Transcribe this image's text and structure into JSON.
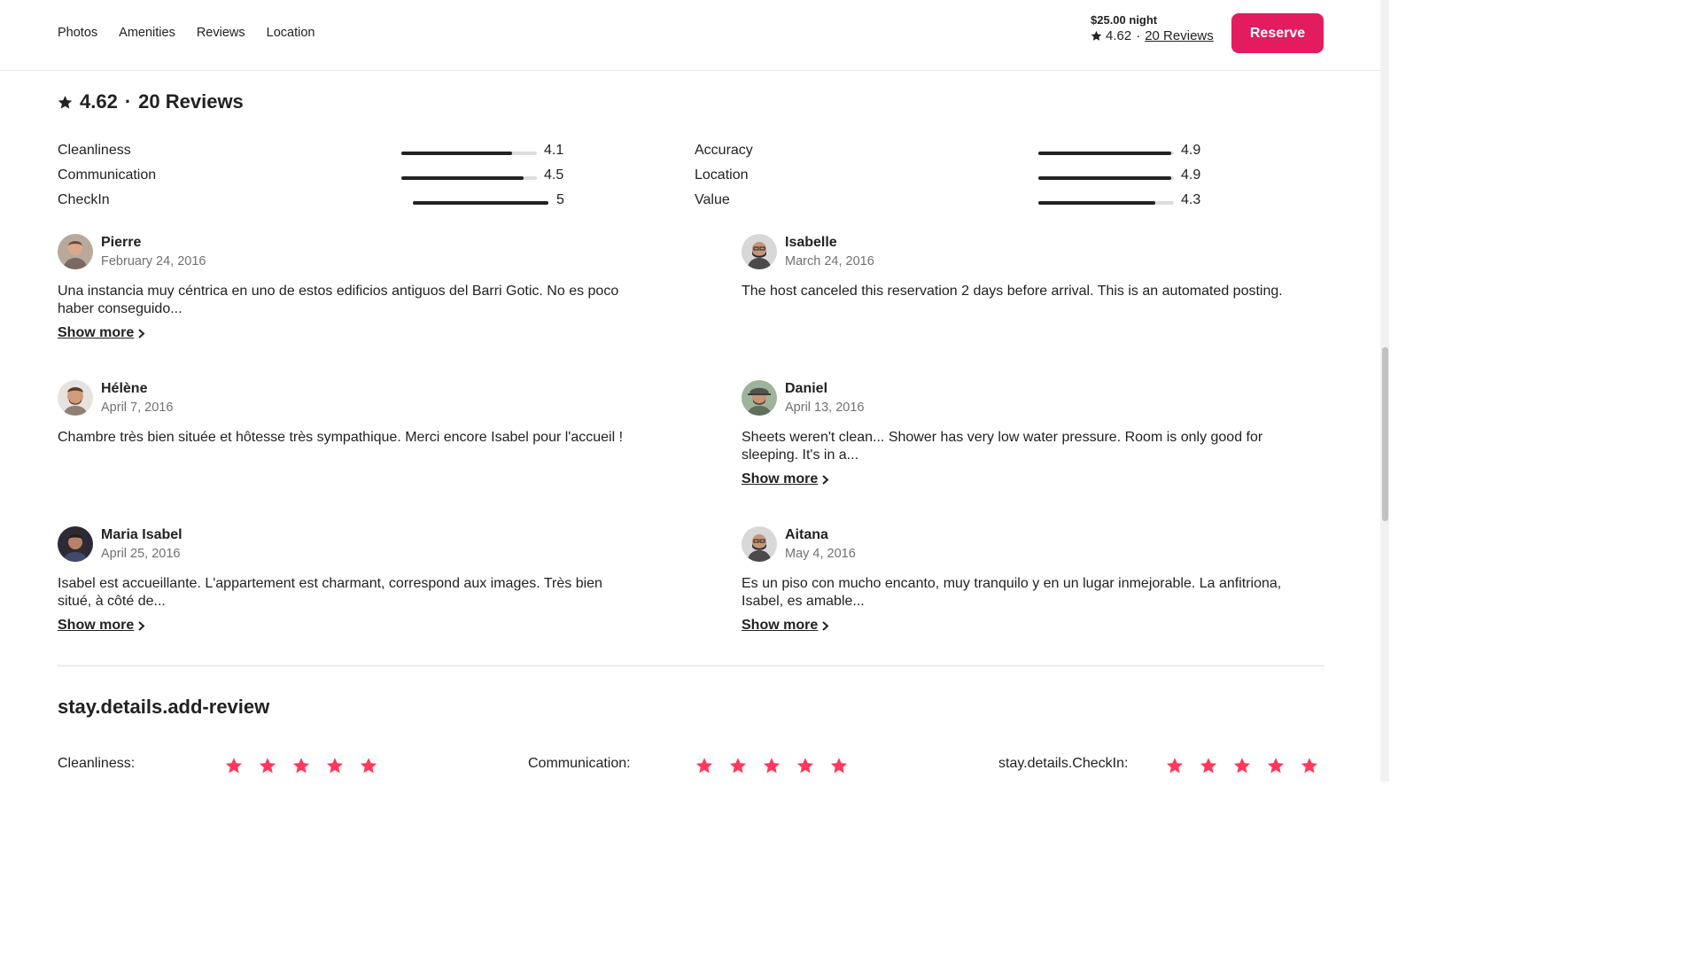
{
  "nav": {
    "items": [
      "Photos",
      "Amenities",
      "Reviews",
      "Location"
    ]
  },
  "header": {
    "price": "$25.00 night",
    "rating": "4.62",
    "separator": "·",
    "reviews_link": "20 Reviews",
    "reserve_label": "Reserve"
  },
  "reviews_section": {
    "rating": "4.62",
    "separator": "·",
    "count_label": "20 Reviews"
  },
  "categories_left": [
    {
      "label": "Cleanliness",
      "value": "4.1",
      "fill": 0.82
    },
    {
      "label": "Communication",
      "value": "4.5",
      "fill": 0.9
    },
    {
      "label": "CheckIn",
      "value": "5",
      "fill": 1.0
    }
  ],
  "categories_right": [
    {
      "label": "Accuracy",
      "value": "4.9",
      "fill": 0.98
    },
    {
      "label": "Location",
      "value": "4.9",
      "fill": 0.98
    },
    {
      "label": "Value",
      "value": "4.3",
      "fill": 0.86
    }
  ],
  "reviews": [
    {
      "name": "Pierre",
      "date": "February 24, 2016",
      "text": "Una instancia muy céntrica en uno de estos edificios antiguos del Barri Gotic. No es poco haber conseguido...",
      "show_more": "Show more"
    },
    {
      "name": "Isabelle",
      "date": "March 24, 2016",
      "text": "The host canceled this reservation 2 days before arrival. This is an automated posting.",
      "show_more": ""
    },
    {
      "name": "Hélène",
      "date": "April 7, 2016",
      "text": "Chambre très bien située et hôtesse très sympathique. Merci encore Isabel pour l'accueil !",
      "show_more": ""
    },
    {
      "name": "Daniel",
      "date": "April 13, 2016",
      "text": "Sheets weren't clean... Shower has very low water pressure. Room is only good for sleeping. It's in a...",
      "show_more": "Show more"
    },
    {
      "name": "Maria Isabel",
      "date": "April 25, 2016",
      "text": "Isabel est accueillante. L'appartement est charmant, correspond aux images. Très bien situé, à côté de...",
      "show_more": "Show more"
    },
    {
      "name": "Aitana",
      "date": "May 4, 2016",
      "text": "Es un piso con mucho encanto, muy tranquilo y en un lugar inmejorable. La anfitriona, Isabel, es amable...",
      "show_more": "Show more"
    }
  ],
  "add_review": {
    "title": "stay.details.add-review",
    "fields": [
      {
        "label": "Cleanliness:",
        "stars": 5
      },
      {
        "label": "Communication:",
        "stars": 5
      },
      {
        "label": "stay.details.CheckIn:",
        "stars": 5
      }
    ]
  },
  "colors": {
    "brand": "#e31c5f",
    "star_pink": "#ff385c",
    "text": "#222222",
    "muted": "#717171"
  },
  "icons": {
    "star": "star-icon",
    "chevron": "chevron-right-icon"
  }
}
